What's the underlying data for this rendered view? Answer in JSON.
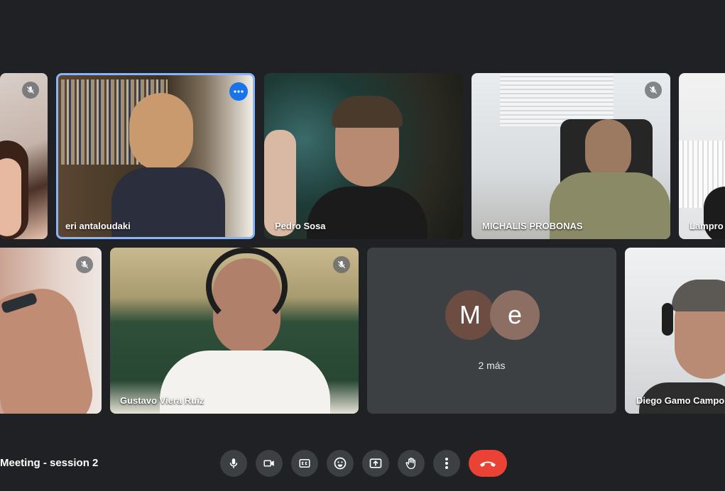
{
  "meeting": {
    "title": "Meeting - session 2"
  },
  "participants": [
    {
      "name": ""
    },
    {
      "name": "eri antaloudaki"
    },
    {
      "name": "Pedro Sosa"
    },
    {
      "name": "MICHALIS PROBONAS"
    },
    {
      "name": "Lampro"
    },
    {
      "name": ""
    },
    {
      "name": "Gustavo Viera Ruiz"
    },
    {
      "name": "Diego Gamo Campo"
    }
  ],
  "others": {
    "avatars": [
      {
        "letter": "M",
        "color": "#6d4c41"
      },
      {
        "letter": "e",
        "color": "#8d6e63"
      }
    ],
    "label": "2 más"
  },
  "controls": [
    {
      "icon": "mic-icon"
    },
    {
      "icon": "camera-icon"
    },
    {
      "icon": "captions-icon"
    },
    {
      "icon": "emoji-icon"
    },
    {
      "icon": "present-icon"
    },
    {
      "icon": "raise-hand-icon"
    },
    {
      "icon": "more-vert-icon"
    },
    {
      "icon": "hang-up-icon"
    }
  ],
  "colors": {
    "background": "#202124",
    "accent": "#1a73e8",
    "hangup": "#ea4335",
    "button": "#3c4043"
  }
}
